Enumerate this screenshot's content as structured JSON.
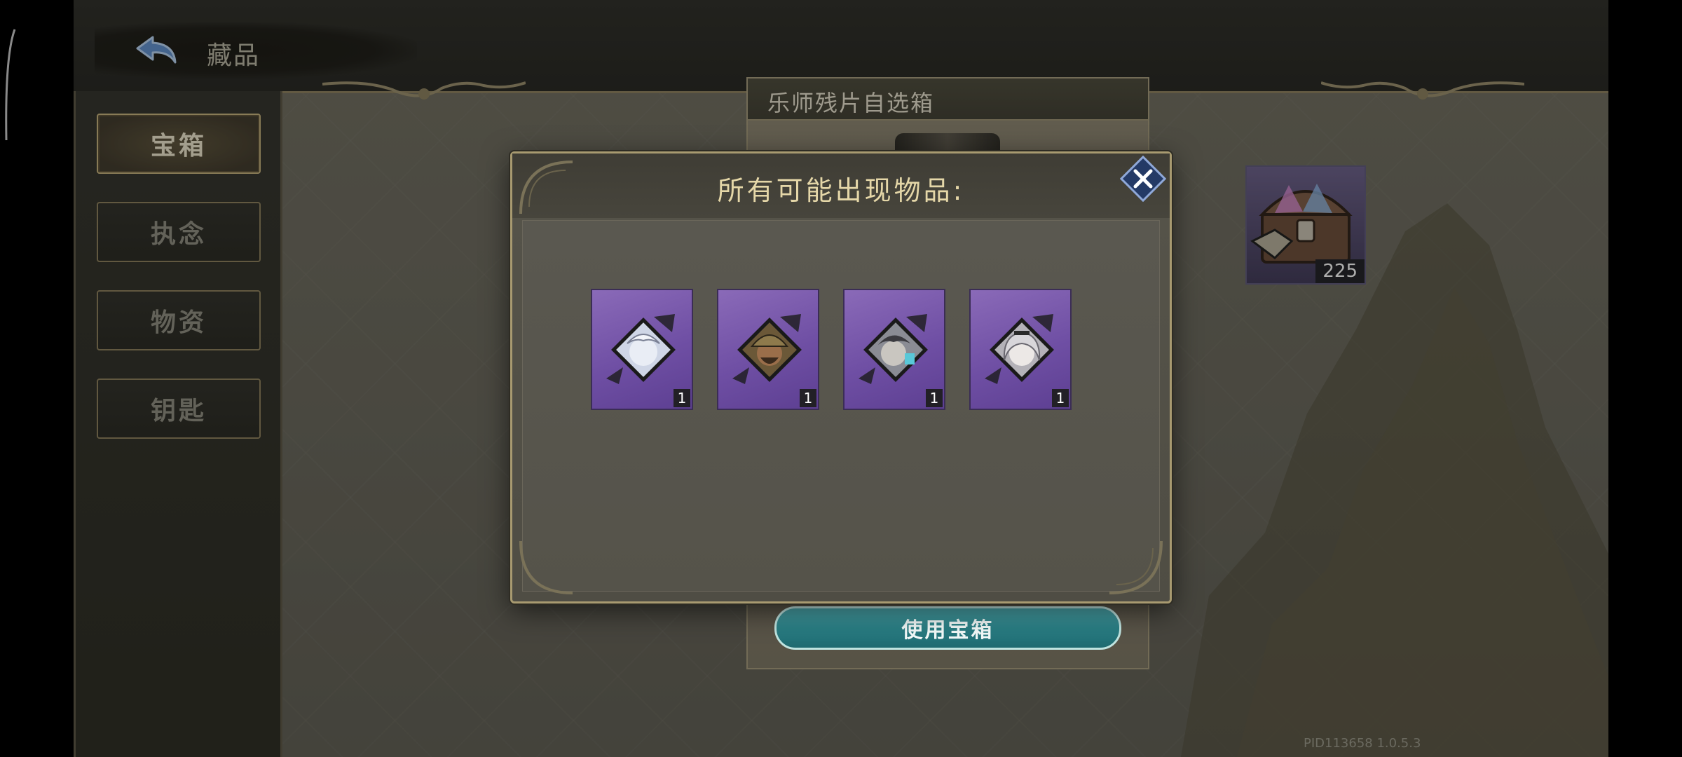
{
  "header": {
    "title": "藏品"
  },
  "sidebar": {
    "tabs": [
      {
        "label": "宝箱",
        "active": true
      },
      {
        "label": "执念",
        "active": false
      },
      {
        "label": "物资",
        "active": false
      },
      {
        "label": "钥匙",
        "active": false
      }
    ]
  },
  "chest_panel": {
    "title": "乐师残片自选箱",
    "use_button_label": "使用宝箱"
  },
  "inventory_item": {
    "icon": "treasure-chest-icon",
    "count": "225"
  },
  "dialog": {
    "title": "所有可能出现物品:",
    "close_icon": "close-icon",
    "rewards": [
      {
        "portrait": "pale-haired-character-portrait",
        "count": "1"
      },
      {
        "portrait": "hooded-bearded-character-portrait",
        "count": "1"
      },
      {
        "portrait": "dark-haired-character-portrait",
        "count": "1"
      },
      {
        "portrait": "white-haired-girl-portrait",
        "count": "1"
      }
    ]
  },
  "footer": {
    "pid_version": "PID113658  1.0.5.3"
  },
  "colors": {
    "accent_gold": "#c7b37c",
    "reward_purple": "#6f4fa4",
    "button_teal": "#2a7f85"
  }
}
